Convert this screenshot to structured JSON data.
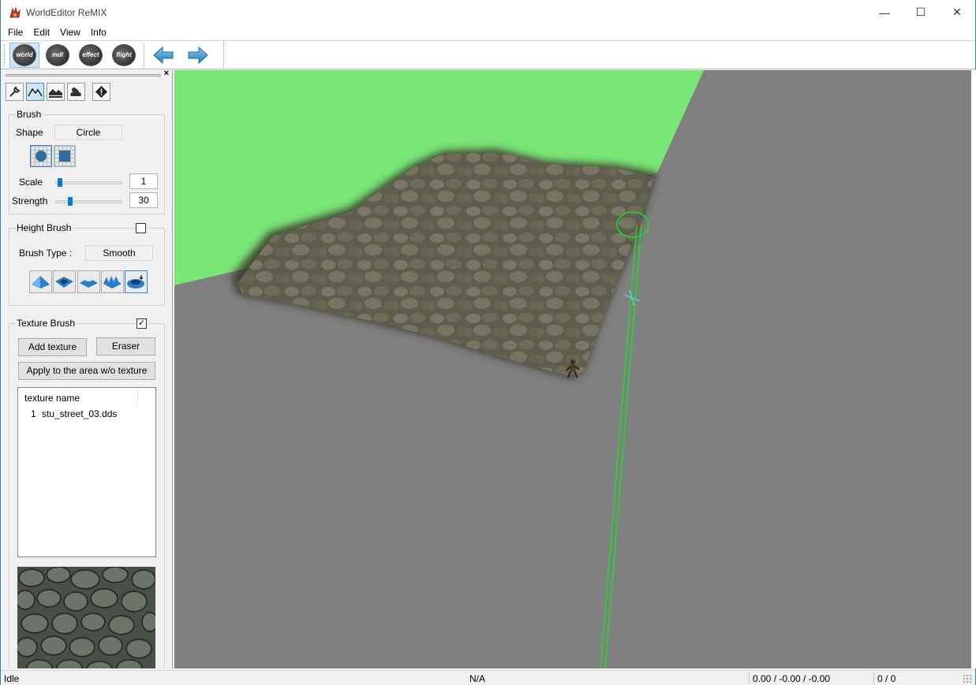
{
  "window": {
    "title": "WorldEditor ReMIX",
    "minimize_glyph": "—",
    "maximize_glyph": "☐",
    "close_glyph": "✕"
  },
  "menu": [
    "File",
    "Edit",
    "View",
    "Info"
  ],
  "toolbar": {
    "buttons": [
      "world",
      "mdl",
      "effect",
      "flight"
    ],
    "active": "world"
  },
  "panel": {
    "close_glyph": "×",
    "tool_tabs": [
      "wrench-icon",
      "terrain-height-icon",
      "terrain-texture-icon",
      "weather-icon",
      "warning-icon"
    ],
    "brush": {
      "title": "Brush",
      "shape_label": "Shape",
      "shape_value": "Circle",
      "scale_label": "Scale",
      "scale_value": "1",
      "strength_label": "Strength",
      "strength_value": "30",
      "scale_fraction": 0.02,
      "strength_fraction": 0.2
    },
    "height_brush": {
      "title": "Height Brush",
      "checked": false,
      "type_label": "Brush Type :",
      "type_value": "Smooth"
    },
    "texture_brush": {
      "title": "Texture Brush",
      "checked": true,
      "check_glyph": "✓",
      "add_texture": "Add texture",
      "eraser": "Eraser",
      "apply_area": "Apply to the area w/o texture",
      "list_header": "texture name",
      "textures": [
        {
          "index": "1",
          "name": "stu_street_03.dds"
        }
      ]
    }
  },
  "status": {
    "state": "Idle",
    "info": "N/A",
    "coords": "0.00 / -0.00 / -0.00",
    "count": "0 / 0"
  },
  "colors": {
    "ground_green": "#7ae676",
    "viewport_gray": "#808080",
    "accent_blue": "#0a78d7"
  }
}
